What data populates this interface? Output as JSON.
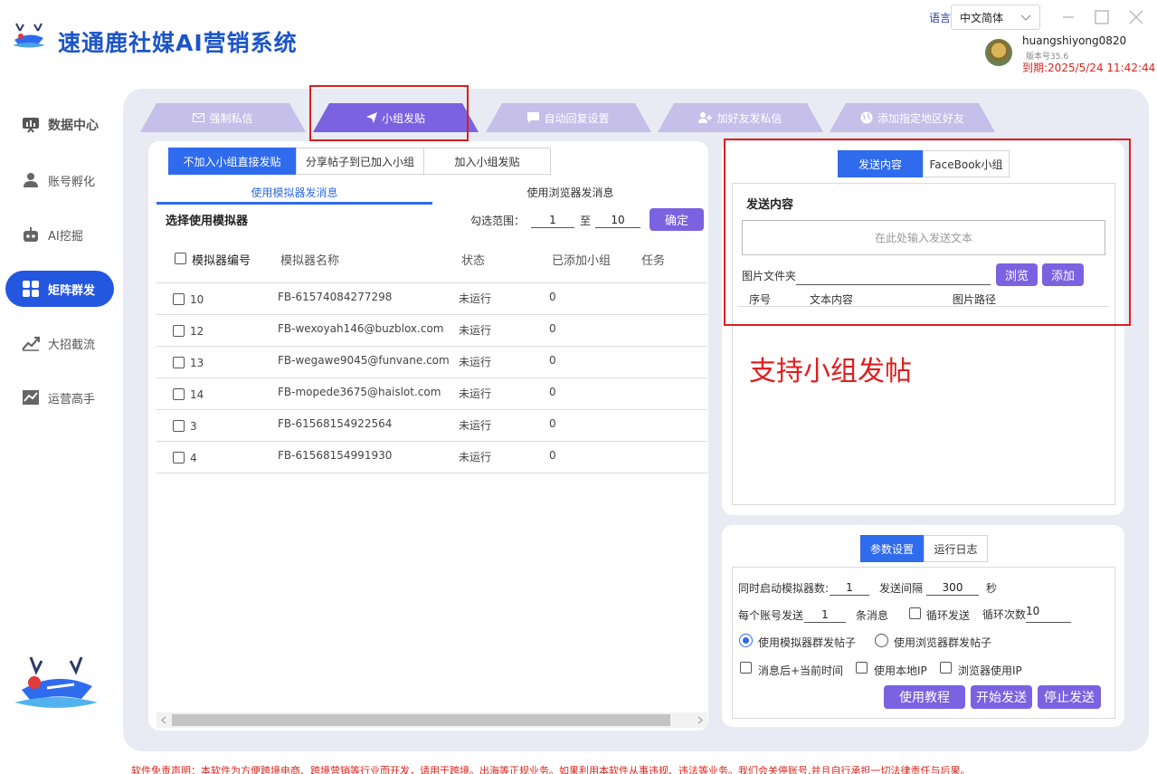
{
  "app": {
    "title": "速通鹿社媒AI营销系统",
    "language_label": "语言",
    "language_value": "中文简体",
    "username": "huangshiyong0820",
    "version": "版本号35.6",
    "expiry": "到期:2025/5/24 11:42:44"
  },
  "sidebar": {
    "items": [
      {
        "label": "数据中心",
        "icon": "chart-board-icon"
      },
      {
        "label": "账号孵化",
        "icon": "user-icon"
      },
      {
        "label": "AI挖掘",
        "icon": "robot-icon"
      },
      {
        "label": "矩阵群发",
        "icon": "grid-icon"
      },
      {
        "label": "大招截流",
        "icon": "trend-icon"
      },
      {
        "label": "运营高手",
        "icon": "line-chart-icon"
      }
    ]
  },
  "tabs": [
    {
      "label": "强制私信",
      "icon": "mail-icon"
    },
    {
      "label": "小组发贴",
      "icon": "send-icon"
    },
    {
      "label": "自动回复设置",
      "icon": "chat-icon"
    },
    {
      "label": "加好友发私信",
      "icon": "add-user-icon"
    },
    {
      "label": "添加指定地区好友",
      "icon": "globe-icon"
    }
  ],
  "left": {
    "modes": [
      "不加入小组直接发贴",
      "分享帖子到已加入小组",
      "加入小组发贴"
    ],
    "subtabs": [
      "使用模拟器发消息",
      "使用浏览器发消息"
    ],
    "select_label": "选择使用模拟器",
    "range_label": "勾选范围：",
    "range_from": "1",
    "range_sep": "至",
    "range_to": "10",
    "confirm": "确定",
    "columns": [
      "模拟器编号",
      "模拟器名称",
      "状态",
      "已添加小组",
      "任务"
    ],
    "rows": [
      {
        "id": "10",
        "name": "FB-61574084277298",
        "status": "未运行",
        "groups": "0"
      },
      {
        "id": "12",
        "name": "FB-wexoyah146@buzblox.com",
        "status": "未运行",
        "groups": "0"
      },
      {
        "id": "13",
        "name": "FB-wegawe9045@funvane.com",
        "status": "未运行",
        "groups": "0"
      },
      {
        "id": "14",
        "name": "FB-mopede3675@haislot.com",
        "status": "未运行",
        "groups": "0"
      },
      {
        "id": "3",
        "name": "FB-61568154922564",
        "status": "未运行",
        "groups": "0"
      },
      {
        "id": "4",
        "name": "FB-61568154991930",
        "status": "未运行",
        "groups": "0"
      }
    ]
  },
  "content": {
    "toggles": [
      "发送内容",
      "FaceBook小组"
    ],
    "section_title": "发送内容",
    "text_placeholder": "在此处输入发送文本",
    "folder_label": "图片文件夹",
    "browse": "浏览",
    "add": "添加",
    "columns": [
      "序号",
      "文本内容",
      "图片路径"
    ],
    "annotation": "支持小组发帖"
  },
  "params": {
    "toggles": [
      "参数设置",
      "运行日志"
    ],
    "concurrent_label": "同时启动模拟器数:",
    "concurrent_value": "1",
    "interval_label": "发送间隔",
    "interval_value": "300",
    "interval_unit": "秒",
    "per_account_label": "每个账号发送",
    "per_account_value": "1",
    "per_account_unit": "条消息",
    "loop_label": "循环发送",
    "loop_count_label": "循环次数",
    "loop_count_value": "10",
    "radio_emulator": "使用模拟器群发帖子",
    "radio_browser": "使用浏览器群发帖子",
    "opt_time": "消息后+当前时间",
    "opt_local_ip": "使用本地IP",
    "opt_browser_ip": "浏览器使用IP",
    "btn_tutorial": "使用教程",
    "btn_start": "开始发送",
    "btn_stop": "停止发送"
  },
  "disclaimer": "软件免责声明：本软件为方便跨境电商、跨境营销等行业而开发，请用于跨境。出海等正规业务。如果利用本软件从事违规、违法等业务。我们会关停账号,并且自行承担一切法律责任与后果。",
  "colors": {
    "primary": "#2f6bed",
    "purple": "#7b62e0",
    "tab_inactive": "#c5bfe9",
    "tab_active": "#7b62e0",
    "highlight": "#e01d1d"
  }
}
